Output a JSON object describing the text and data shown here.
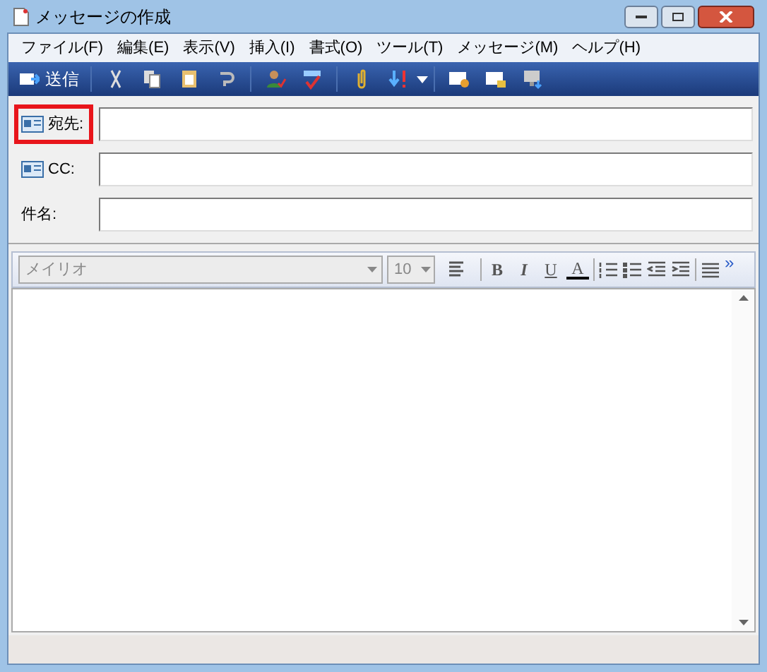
{
  "window": {
    "title": "メッセージの作成"
  },
  "menu": [
    {
      "label": "ファイル(F)"
    },
    {
      "label": "編集(E)"
    },
    {
      "label": "表示(V)"
    },
    {
      "label": "挿入(I)"
    },
    {
      "label": "書式(O)"
    },
    {
      "label": "ツール(T)"
    },
    {
      "label": "メッセージ(M)"
    },
    {
      "label": "ヘルプ(H)"
    }
  ],
  "toolbar": {
    "send": "送信"
  },
  "fields": [
    {
      "label": "宛先:",
      "kind": "address",
      "highlighted": true
    },
    {
      "label": "CC:",
      "kind": "address",
      "highlighted": false
    },
    {
      "label": "件名:",
      "kind": "plain",
      "highlighted": false
    }
  ],
  "format_bar": {
    "font": "メイリオ",
    "size": "10",
    "bold": "B",
    "italic": "I",
    "underline": "U",
    "font_color": "A",
    "more": "»"
  }
}
